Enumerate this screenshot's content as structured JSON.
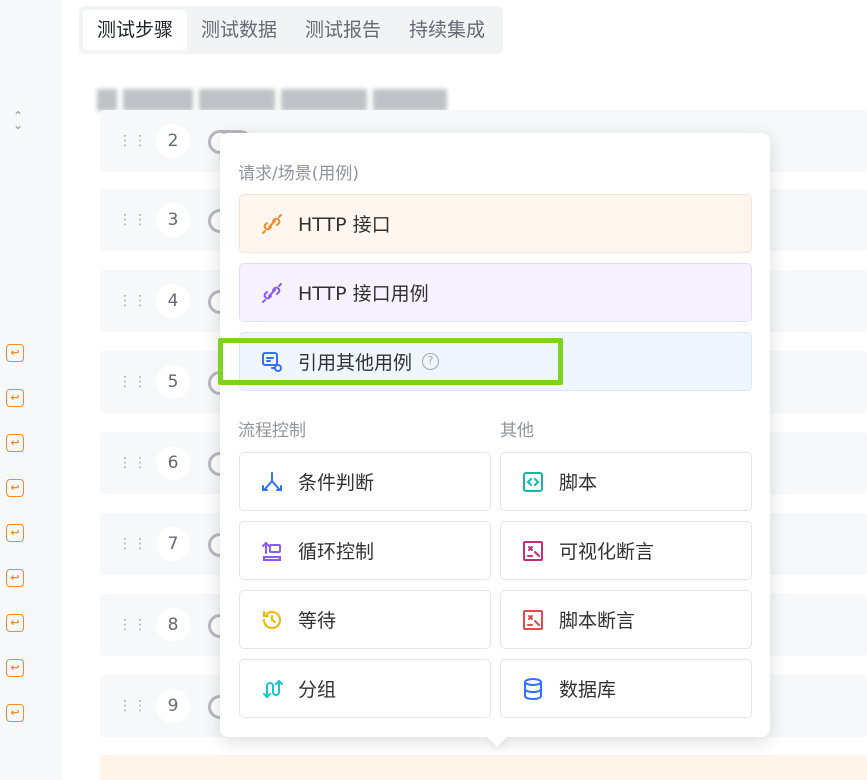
{
  "tabs": [
    {
      "label": "测试步骤",
      "active": true
    },
    {
      "label": "测试数据",
      "active": false
    },
    {
      "label": "测试报告",
      "active": false
    },
    {
      "label": "持续集成",
      "active": false
    }
  ],
  "steps": [
    {
      "num": "2"
    },
    {
      "num": "3"
    },
    {
      "num": "4"
    },
    {
      "num": "5"
    },
    {
      "num": "6"
    },
    {
      "num": "7"
    },
    {
      "num": "8"
    },
    {
      "num": "9"
    }
  ],
  "popover": {
    "request_section": "请求/场景(用例)",
    "http_api": "HTTP 接口",
    "http_case": "HTTP 接口用例",
    "ref_case": "引用其他用例",
    "help_glyph": "?",
    "flow_section": "流程控制",
    "other_section": "其他",
    "flow_items": [
      "条件判断",
      "循环控制",
      "等待",
      "分组"
    ],
    "other_items": [
      "脚本",
      "可视化断言",
      "脚本断言",
      "数据库"
    ]
  },
  "colors": {
    "http": "#f08c2b",
    "http_case": "#8a5cf5",
    "ref": "#3370ff",
    "condition": "#3370ff",
    "loop": "#8a5cf5",
    "wait": "#f5b400",
    "group": "#14c9c9",
    "script": "#14b8a6",
    "visual_assert": "#c0307a",
    "script_assert": "#e5484d",
    "database": "#3370ff",
    "highlight": "#7ed321"
  }
}
